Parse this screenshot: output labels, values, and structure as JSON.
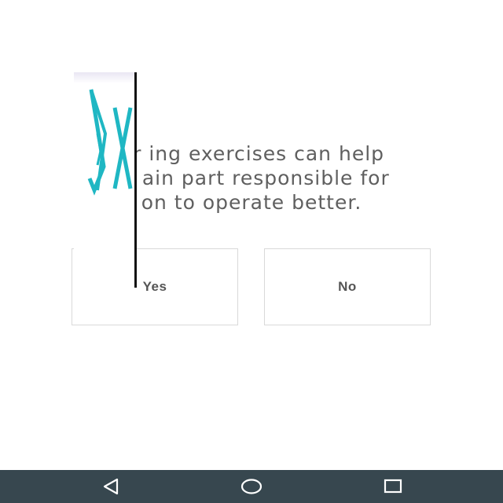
{
  "question": {
    "lines": [
      "Breathing exercises can help",
      "the brain part responsible for",
      "emotion to operate better."
    ],
    "visible_lines": [
      "Br      ing exercises can help",
      "th       ain part responsible for",
      "         on to operate better."
    ]
  },
  "answers": {
    "yes_label": "Yes",
    "no_label": "No"
  },
  "navbar": {
    "back_icon": "back-triangle-icon",
    "home_icon": "home-circle-icon",
    "recent_icon": "recent-apps-square-icon",
    "background": "#37474f"
  },
  "colors": {
    "text": "#5f5f5f",
    "overlay_glyph": "#1fb7c3",
    "button_border": "#d9d9d9"
  }
}
